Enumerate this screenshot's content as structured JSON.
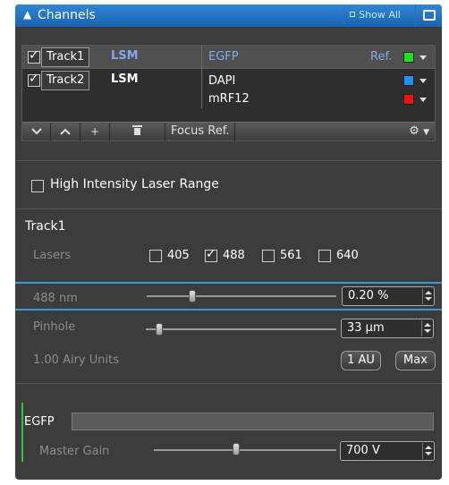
{
  "header": {
    "title": "Channels",
    "show_all": "Show All"
  },
  "tracks": [
    {
      "name": "Track1",
      "type": "LSM",
      "checked": true,
      "dyes": [
        {
          "name": "EGFP",
          "ref": "Ref.",
          "color": "#22dd22"
        }
      ]
    },
    {
      "name": "Track2",
      "type": "LSM",
      "checked": true,
      "dyes": [
        {
          "name": "DAPI",
          "color": "#1e90ff"
        },
        {
          "name": "mRF12",
          "color": "#ee1111"
        }
      ]
    }
  ],
  "toolbar": {
    "buttons": [
      "expand-down",
      "collapse-up",
      "add",
      "delete"
    ],
    "add_label": "+",
    "focus_ref": "Focus Ref."
  },
  "high_intensity": {
    "label": "High Intensity Laser Range",
    "checked": false
  },
  "track_section": {
    "title": "Track1",
    "lasers_label": "Lasers",
    "lasers": [
      {
        "wavelength": "405",
        "checked": false
      },
      {
        "wavelength": "488",
        "checked": true
      },
      {
        "wavelength": "561",
        "checked": false
      },
      {
        "wavelength": "640",
        "checked": false
      }
    ],
    "laser_power": {
      "label": "488 nm",
      "value": "0.20 %",
      "slider_fraction": 0.24
    },
    "pinhole": {
      "label": "Pinhole",
      "value": "33 µm",
      "slider_fraction": 0.07,
      "airy_label": "1.00 Airy Units",
      "au_button": "1 AU",
      "max_button": "Max"
    }
  },
  "channel": {
    "name": "EGFP",
    "master_gain": {
      "label": "Master Gain",
      "value": "700 V",
      "slider_fraction": 0.45
    }
  },
  "colors": {
    "title_bar": "#1f6fc0",
    "selection_border": "#3a9ad9",
    "egfp_accent": "#28c845",
    "ref_text": "#7fa9ec"
  }
}
